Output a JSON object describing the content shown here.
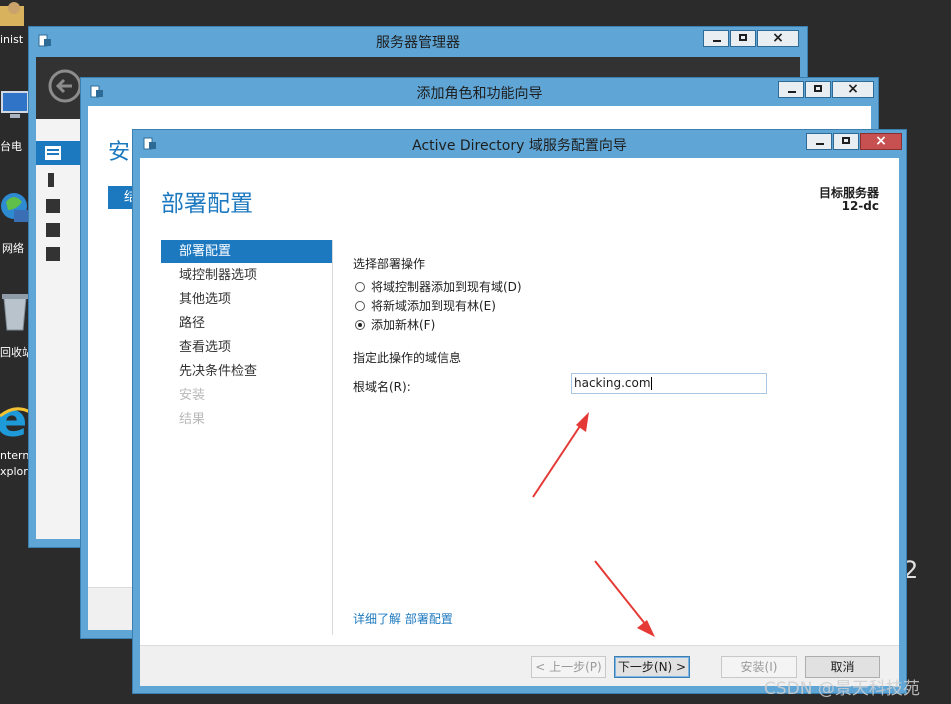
{
  "desktop": {
    "labels": [
      "inist",
      "台电",
      "网络",
      "回收站",
      "nterne",
      "xplor"
    ],
    "watermark": "CSDN @景天科技苑",
    "partial_digit": "2"
  },
  "server_manager": {
    "title": "服务器管理器"
  },
  "roles_wizard": {
    "title": "添加角色和功能向导",
    "heading_partial": "安",
    "partial_button": "结"
  },
  "adds_wizard": {
    "title": "Active Directory 域服务配置向导",
    "page_title": "部署配置",
    "target_server_label": "目标服务器",
    "target_server_name": "12-dc",
    "nav": [
      "部署配置",
      "域控制器选项",
      "其他选项",
      "路径",
      "查看选项",
      "先决条件检查",
      "安装",
      "结果"
    ],
    "section_operation": "选择部署操作",
    "options": [
      {
        "label": "将域控制器添加到现有域(D)",
        "selected": false
      },
      {
        "label": "将新域添加到现有林(E)",
        "selected": false
      },
      {
        "label": "添加新林(F)",
        "selected": true
      }
    ],
    "section_domain": "指定此操作的域信息",
    "root_domain_label": "根域名(R):",
    "root_domain_value": "hacking.com",
    "more_link": "详细了解 部署配置",
    "buttons": {
      "prev": "< 上一步(P)",
      "next": "下一步(N) >",
      "install": "安装(I)",
      "cancel": "取消"
    }
  },
  "colors": {
    "window_frame": "#5fa6d6",
    "selected_nav": "#1c79c0",
    "annotation_arrow": "#e53935"
  }
}
